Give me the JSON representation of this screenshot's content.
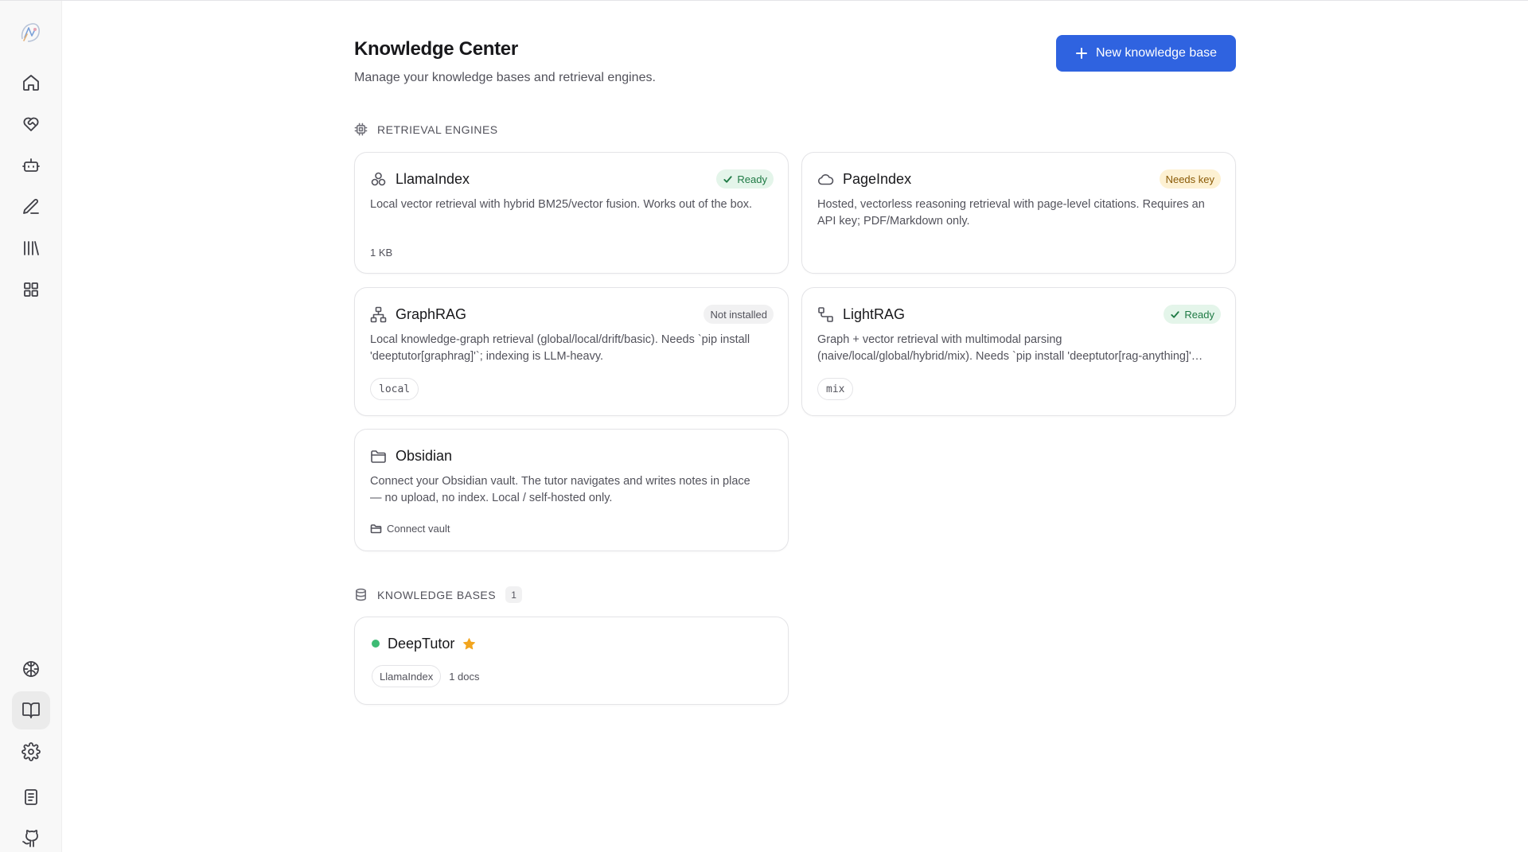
{
  "sidebar": {
    "logo_icon": "app-logo-icon",
    "top_items": [
      {
        "icon": "home-icon"
      },
      {
        "icon": "heart-handshake-icon"
      },
      {
        "icon": "bot-icon"
      },
      {
        "icon": "pen-icon"
      },
      {
        "icon": "library-icon"
      },
      {
        "icon": "apps-grid-icon"
      }
    ],
    "bottom_items": [
      {
        "icon": "brain-icon"
      },
      {
        "icon": "book-open-icon",
        "active": true
      },
      {
        "icon": "gear-icon"
      },
      {
        "icon": "notebook-icon"
      },
      {
        "icon": "github-icon"
      }
    ]
  },
  "header": {
    "title": "Knowledge Center",
    "subtitle": "Manage your knowledge bases and retrieval engines.",
    "new_button_label": "New knowledge base"
  },
  "engines_section": {
    "heading": "RETRIEVAL ENGINES",
    "engines": [
      {
        "name": "LlamaIndex",
        "icon": "nodes-icon",
        "status": "Ready",
        "description": "Local vector retrieval with hybrid BM25/vector fusion. Works out of the box.",
        "meta": "1 KB"
      },
      {
        "name": "PageIndex",
        "icon": "cloud-icon",
        "status": "Needs key",
        "description": "Hosted, vectorless reasoning retrieval with page-level citations. Requires an API key; PDF/Markdown only."
      },
      {
        "name": "GraphRAG",
        "icon": "network-icon",
        "status": "Not installed",
        "description": "Local knowledge-graph retrieval (global/local/drift/basic). Needs `pip install 'deeptutor[graphrag]'`; indexing is LLM-heavy.",
        "mode": "local"
      },
      {
        "name": "LightRAG",
        "icon": "route-icon",
        "status": "Ready",
        "description_line1": "Graph + vector retrieval with multimodal parsing",
        "description_line2": "(naive/local/global/hybrid/mix). Needs `pip install 'deeptutor[rag-anything]'`; multimodal parsing.",
        "mode": "mix"
      },
      {
        "name": "Obsidian",
        "icon": "folder-icon",
        "description": "Connect your Obsidian vault. The tutor navigates and writes notes in place — no upload, no index. Local / self-hosted only.",
        "action": "Connect vault"
      }
    ]
  },
  "kb_section": {
    "heading": "KNOWLEDGE BASES",
    "count": "1",
    "items": [
      {
        "name": "DeepTutor",
        "engine": "LlamaIndex",
        "docs": "1 docs",
        "status_color": "#3dbb74",
        "star_color": "#f2a51e"
      }
    ]
  },
  "colors": {
    "accent": "#2f63e0",
    "ready_bg": "#e4f5ea",
    "needs_key_bg": "#fdf1d3",
    "not_installed_bg": "#f1f1f2"
  }
}
